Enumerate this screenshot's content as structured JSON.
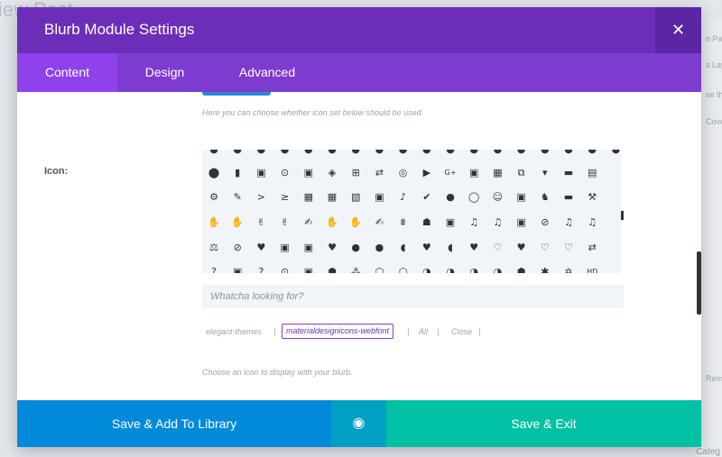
{
  "background": {
    "title_fragment": "iew Post",
    "side_labels": [
      "n Pag",
      "s Lay",
      "se the",
      "Cover",
      "Remo",
      "Categ"
    ],
    "category_fragment": "Categ"
  },
  "modal": {
    "title": "Blurb Module Settings",
    "close_icon": "close-icon",
    "tabs": [
      {
        "label": "Content",
        "active": true
      },
      {
        "label": "Design",
        "active": false
      },
      {
        "label": "Advanced",
        "active": false
      }
    ]
  },
  "icon_set_hint": "Here you can choose whether icon set below should be used.",
  "icon_field": {
    "label": "Icon:",
    "search_placeholder": "Whatcha looking for?",
    "sets": {
      "items": [
        "elegant-themes",
        "|",
        "materialdesignicons-webfont",
        "|",
        "All",
        "|",
        "Close",
        "|"
      ],
      "active": "materialdesignicons-webfont"
    },
    "hint": "Choose an icon to display with your blurb."
  },
  "icon_rows": [
    [
      "●",
      "●",
      "●",
      "●",
      "●",
      "●",
      "●",
      "●",
      "●",
      "●",
      "●",
      "●",
      "●",
      "●",
      "●",
      "●",
      "●",
      "●",
      "●",
      "●"
    ],
    [
      "⬤",
      "▮",
      "▣",
      "⊙",
      "▣",
      "◈",
      "⊞",
      "⇄",
      "◎",
      "▶",
      "G+",
      "▣",
      "▦",
      "⧉",
      "▾",
      "▬",
      "▤"
    ],
    [
      "⚙",
      "✎",
      ">",
      "≥",
      "▦",
      "▦",
      "▧",
      "▣",
      "♪",
      "✔",
      "●",
      "◯",
      "☺",
      "▣",
      "♞",
      "▬",
      "⚒"
    ],
    [
      "✋",
      "✋",
      "✌",
      "✌",
      "✍",
      "✋",
      "✋",
      "✍",
      "⩩",
      "☗",
      "▣",
      "♫",
      "♫",
      "▣",
      "⊘",
      "♫",
      "♫"
    ],
    [
      "⚖",
      "⊘",
      "♥",
      "▣",
      "▣",
      "♥",
      "●",
      "●",
      "◖",
      "♥",
      "◖",
      "♥",
      "♡",
      "♥",
      "♡",
      "♡",
      "⇄"
    ],
    [
      "?",
      "▣",
      "?",
      "⊙",
      "▣",
      "⬢",
      "⁂",
      "⬡",
      "⬡",
      "◑",
      "◑",
      "◑",
      "◑",
      "⬢",
      "✱",
      "✡",
      "HD"
    ]
  ],
  "footer": {
    "save_library": "Save & Add To Library",
    "eye_icon": "eye-icon",
    "save_exit": "Save & Exit"
  },
  "colors": {
    "header": "#6c2eb9",
    "tabs": "#7e3bd0",
    "active_tab": "#8f42ec",
    "library_button": "#008ad9",
    "eye_button": "#00a0c4",
    "save_button": "#00c1a4"
  }
}
